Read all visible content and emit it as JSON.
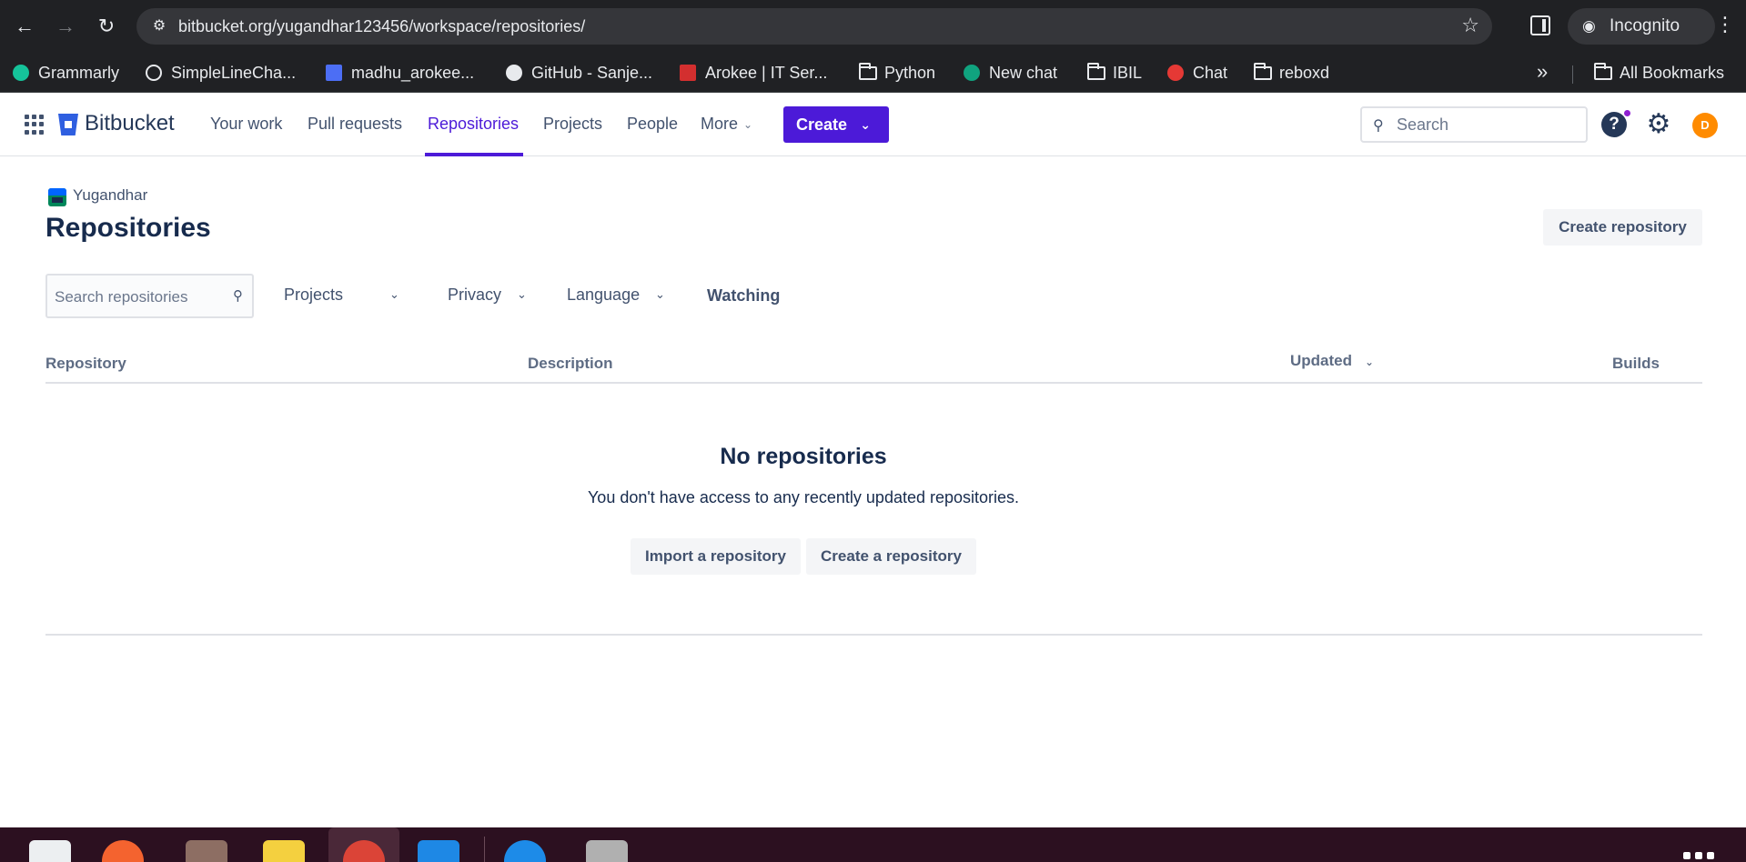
{
  "browser": {
    "url": "bitbucket.org/yugandhar123456/workspace/repositories/",
    "incognito_label": "Incognito",
    "bookmarks": [
      {
        "label": "Grammarly",
        "icon": "grammarly-icon",
        "color": "#15c39a"
      },
      {
        "label": "SimpleLineCha...",
        "icon": "web-icon",
        "color": "#e8eaed"
      },
      {
        "label": "madhu_arokee...",
        "icon": "bitbucket-icon",
        "color": "#4c6ef5"
      },
      {
        "label": "GitHub - Sanje...",
        "icon": "github-icon",
        "color": "#e8eaed"
      },
      {
        "label": "Arokee | IT Ser...",
        "icon": "arokee-icon",
        "color": "#d32f2f"
      },
      {
        "label": "Python",
        "icon": "folder-icon"
      },
      {
        "label": "New chat",
        "icon": "chatgpt-icon",
        "color": "#10a37f"
      },
      {
        "label": "IBIL",
        "icon": "folder-icon"
      },
      {
        "label": "Chat",
        "icon": "chat-icon",
        "color": "#e53935"
      },
      {
        "label": "reboxd",
        "icon": "folder-icon"
      }
    ],
    "all_bookmarks": "All Bookmarks"
  },
  "topnav": {
    "brand": "Bitbucket",
    "items": [
      "Your work",
      "Pull requests",
      "Repositories",
      "Projects",
      "People",
      "More"
    ],
    "active": "Repositories",
    "create_label": "Create",
    "search_placeholder": "Search",
    "avatar_initial": "D",
    "accent": "#4c1ad8"
  },
  "page": {
    "workspace": "Yugandhar",
    "title": "Repositories",
    "create_repository": "Create repository"
  },
  "filters": {
    "search_placeholder": "Search repositories",
    "projects": "Projects",
    "privacy": "Privacy",
    "language": "Language",
    "watching": "Watching"
  },
  "table": {
    "columns": [
      "Repository",
      "Description",
      "Updated",
      "Builds"
    ]
  },
  "empty_state": {
    "title": "No repositories",
    "description": "You don't have access to any recently updated repositories.",
    "import_button": "Import a repository",
    "create_button": "Create a repository"
  }
}
